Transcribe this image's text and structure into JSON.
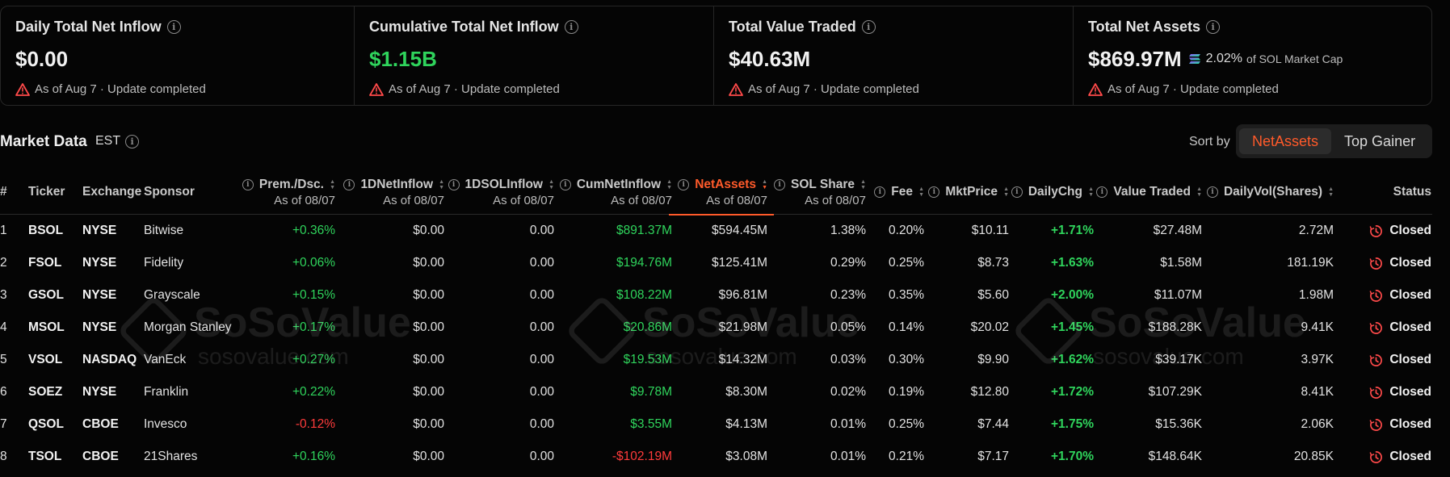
{
  "cards": [
    {
      "title": "Daily Total Net Inflow",
      "value": "$0.00",
      "value_color": "default",
      "status": "As of Aug 7 · Update completed"
    },
    {
      "title": "Cumulative Total Net Inflow",
      "value": "$1.15B",
      "value_color": "green",
      "status": "As of Aug 7 · Update completed"
    },
    {
      "title": "Total Value Traded",
      "value": "$40.63M",
      "value_color": "default",
      "status": "As of Aug 7 · Update completed"
    },
    {
      "title": "Total Net Assets",
      "value": "$869.97M",
      "value_color": "default",
      "extra_pct": "2.02%",
      "extra_text": "of SOL Market Cap",
      "status": "As of Aug 7 · Update completed"
    }
  ],
  "toolbar": {
    "title": "Market Data",
    "timezone": "EST",
    "sort_label": "Sort by",
    "sort_options": [
      "NetAssets",
      "Top Gainer"
    ],
    "active_sort": "NetAssets"
  },
  "columns": [
    {
      "key": "idx",
      "label": "#"
    },
    {
      "key": "ticker",
      "label": "Ticker"
    },
    {
      "key": "exchange",
      "label": "Exchange"
    },
    {
      "key": "sponsor",
      "label": "Sponsor"
    },
    {
      "key": "prem",
      "label": "Prem./Dsc.",
      "sub": "As of 08/07"
    },
    {
      "key": "net1d",
      "label": "1DNetInflow",
      "sub": "As of 08/07"
    },
    {
      "key": "sol1d",
      "label": "1DSOLInflow",
      "sub": "As of 08/07"
    },
    {
      "key": "cum",
      "label": "CumNetInflow",
      "sub": "As of 08/07"
    },
    {
      "key": "assets",
      "label": "NetAssets",
      "sub": "As of 08/07"
    },
    {
      "key": "share",
      "label": "SOL Share",
      "sub": "As of 08/07"
    },
    {
      "key": "fee",
      "label": "Fee"
    },
    {
      "key": "price",
      "label": "MktPrice"
    },
    {
      "key": "chg",
      "label": "DailyChg"
    },
    {
      "key": "traded",
      "label": "Value Traded"
    },
    {
      "key": "vol",
      "label": "DailyVol(Shares)"
    },
    {
      "key": "status",
      "label": "Status"
    }
  ],
  "rows": [
    {
      "idx": "1",
      "ticker": "BSOL",
      "exchange": "NYSE",
      "sponsor": "Bitwise",
      "prem": "+0.36%",
      "net1d": "$0.00",
      "sol1d": "0.00",
      "cum": "$891.37M",
      "assets": "$594.45M",
      "share": "1.38%",
      "fee": "0.20%",
      "price": "$10.11",
      "chg": "+1.71%",
      "traded": "$27.48M",
      "vol": "2.72M",
      "status": "Closed"
    },
    {
      "idx": "2",
      "ticker": "FSOL",
      "exchange": "NYSE",
      "sponsor": "Fidelity",
      "prem": "+0.06%",
      "net1d": "$0.00",
      "sol1d": "0.00",
      "cum": "$194.76M",
      "assets": "$125.41M",
      "share": "0.29%",
      "fee": "0.25%",
      "price": "$8.73",
      "chg": "+1.63%",
      "traded": "$1.58M",
      "vol": "181.19K",
      "status": "Closed"
    },
    {
      "idx": "3",
      "ticker": "GSOL",
      "exchange": "NYSE",
      "sponsor": "Grayscale",
      "prem": "+0.15%",
      "net1d": "$0.00",
      "sol1d": "0.00",
      "cum": "$108.22M",
      "assets": "$96.81M",
      "share": "0.23%",
      "fee": "0.35%",
      "price": "$5.60",
      "chg": "+2.00%",
      "traded": "$11.07M",
      "vol": "1.98M",
      "status": "Closed"
    },
    {
      "idx": "4",
      "ticker": "MSOL",
      "exchange": "NYSE",
      "sponsor": "Morgan Stanley",
      "prem": "+0.17%",
      "net1d": "$0.00",
      "sol1d": "0.00",
      "cum": "$20.86M",
      "assets": "$21.98M",
      "share": "0.05%",
      "fee": "0.14%",
      "price": "$20.02",
      "chg": "+1.45%",
      "traded": "$188.28K",
      "vol": "9.41K",
      "status": "Closed"
    },
    {
      "idx": "5",
      "ticker": "VSOL",
      "exchange": "NASDAQ",
      "sponsor": "VanEck",
      "prem": "+0.27%",
      "net1d": "$0.00",
      "sol1d": "0.00",
      "cum": "$19.53M",
      "assets": "$14.32M",
      "share": "0.03%",
      "fee": "0.30%",
      "price": "$9.90",
      "chg": "+1.62%",
      "traded": "$39.17K",
      "vol": "3.97K",
      "status": "Closed"
    },
    {
      "idx": "6",
      "ticker": "SOEZ",
      "exchange": "NYSE",
      "sponsor": "Franklin",
      "prem": "+0.22%",
      "net1d": "$0.00",
      "sol1d": "0.00",
      "cum": "$9.78M",
      "assets": "$8.30M",
      "share": "0.02%",
      "fee": "0.19%",
      "price": "$12.80",
      "chg": "+1.72%",
      "traded": "$107.29K",
      "vol": "8.41K",
      "status": "Closed"
    },
    {
      "idx": "7",
      "ticker": "QSOL",
      "exchange": "CBOE",
      "sponsor": "Invesco",
      "prem": "-0.12%",
      "net1d": "$0.00",
      "sol1d": "0.00",
      "cum": "$3.55M",
      "assets": "$4.13M",
      "share": "0.01%",
      "fee": "0.25%",
      "price": "$7.44",
      "chg": "+1.75%",
      "traded": "$15.36K",
      "vol": "2.06K",
      "status": "Closed"
    },
    {
      "idx": "8",
      "ticker": "TSOL",
      "exchange": "CBOE",
      "sponsor": "21Shares",
      "prem": "+0.16%",
      "net1d": "$0.00",
      "sol1d": "0.00",
      "cum": "-$102.19M",
      "assets": "$3.08M",
      "share": "0.01%",
      "fee": "0.21%",
      "price": "$7.17",
      "chg": "+1.70%",
      "traded": "$148.64K",
      "vol": "20.85K",
      "status": "Closed"
    }
  ],
  "watermark": {
    "brand": "SoSoValue",
    "site": "sosovalue.com"
  },
  "colors": {
    "green": "#2fd45c",
    "red": "#ff3b3b",
    "accent": "#ff5a2a",
    "background": "#050505"
  }
}
